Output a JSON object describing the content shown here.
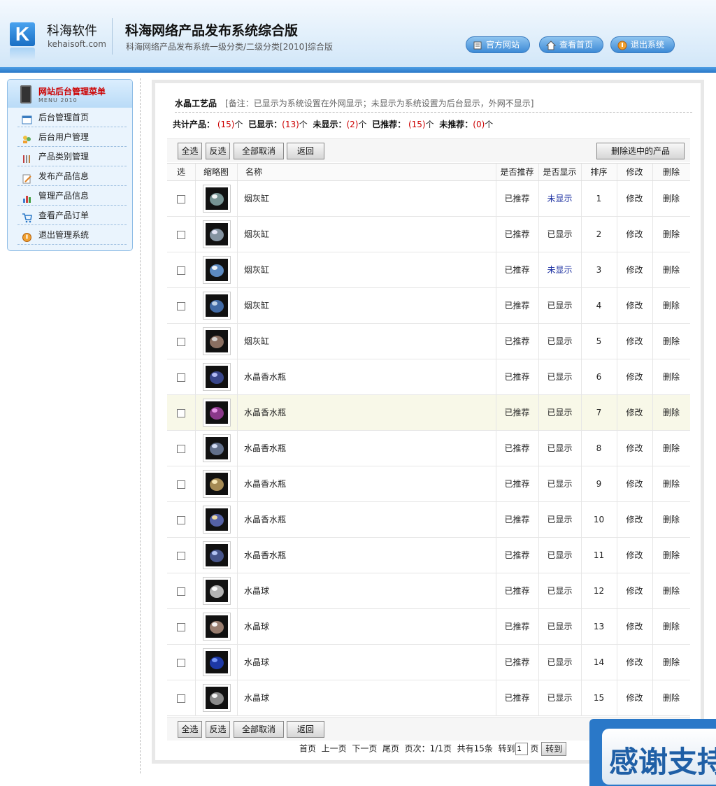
{
  "header": {
    "logo_letter": "K",
    "brand_name": "科海软件",
    "brand_url": "kehaisoft.com",
    "system_title": "科海网络产品发布系统综合版",
    "system_subtitle": "科海网络产品发布系统一级分类/二级分类[2010]综合版",
    "buttons": [
      {
        "label": "官方网站",
        "icon": "document-icon"
      },
      {
        "label": "查看首页",
        "icon": "home-icon"
      },
      {
        "label": "退出系统",
        "icon": "exit-icon"
      }
    ]
  },
  "sidebar": {
    "title": "网站后台管理菜单",
    "subtitle": "MENU 2010",
    "items": [
      {
        "label": "后台管理首页",
        "icon": "window-icon"
      },
      {
        "label": "后台用户管理",
        "icon": "users-icon"
      },
      {
        "label": "产品类别管理",
        "icon": "tools-icon"
      },
      {
        "label": "发布产品信息",
        "icon": "edit-icon"
      },
      {
        "label": "管理产品信息",
        "icon": "chart-icon"
      },
      {
        "label": "查看产品订单",
        "icon": "cart-icon"
      },
      {
        "label": "退出管理系统",
        "icon": "exit-icon"
      }
    ]
  },
  "main": {
    "category": "水晶工艺品",
    "note": "[备注：已显示为系统设置在外网显示；未显示为系统设置为后台显示，外网不显示]",
    "stats": {
      "total_label": "共计产品：",
      "total": "(15)",
      "shown_label": "已显示：",
      "shown": "(13)",
      "hidden_label": "未显示：",
      "hidden": "(2)",
      "recommended_label": "已推荐：",
      "recommended": "(15)",
      "not_recommended_label": "未推荐：",
      "not_recommended": "(0)",
      "unit": "个"
    },
    "buttons": {
      "select_all": "全选",
      "invert": "反选",
      "cancel_all": "全部取消",
      "back": "返回",
      "delete_selected": "删除选中的产品"
    },
    "columns": {
      "select": "选",
      "thumb": "缩略图",
      "name": "名称",
      "recommended": "是否推荐",
      "shown": "是否显示",
      "order": "排序",
      "edit": "修改",
      "delete": "删除"
    },
    "rows": [
      {
        "name": "烟灰缸",
        "recommended": "已推荐",
        "shown": "未显示",
        "order": "1",
        "edit": "修改",
        "delete": "删除"
      },
      {
        "name": "烟灰缸",
        "recommended": "已推荐",
        "shown": "已显示",
        "order": "2",
        "edit": "修改",
        "delete": "删除"
      },
      {
        "name": "烟灰缸",
        "recommended": "已推荐",
        "shown": "未显示",
        "order": "3",
        "edit": "修改",
        "delete": "删除"
      },
      {
        "name": "烟灰缸",
        "recommended": "已推荐",
        "shown": "已显示",
        "order": "4",
        "edit": "修改",
        "delete": "删除"
      },
      {
        "name": "烟灰缸",
        "recommended": "已推荐",
        "shown": "已显示",
        "order": "5",
        "edit": "修改",
        "delete": "删除"
      },
      {
        "name": "水晶香水瓶",
        "recommended": "已推荐",
        "shown": "已显示",
        "order": "6",
        "edit": "修改",
        "delete": "删除"
      },
      {
        "name": "水晶香水瓶",
        "recommended": "已推荐",
        "shown": "已显示",
        "order": "7",
        "edit": "修改",
        "delete": "删除"
      },
      {
        "name": "水晶香水瓶",
        "recommended": "已推荐",
        "shown": "已显示",
        "order": "8",
        "edit": "修改",
        "delete": "删除"
      },
      {
        "name": "水晶香水瓶",
        "recommended": "已推荐",
        "shown": "已显示",
        "order": "9",
        "edit": "修改",
        "delete": "删除"
      },
      {
        "name": "水晶香水瓶",
        "recommended": "已推荐",
        "shown": "已显示",
        "order": "10",
        "edit": "修改",
        "delete": "删除"
      },
      {
        "name": "水晶香水瓶",
        "recommended": "已推荐",
        "shown": "已显示",
        "order": "11",
        "edit": "修改",
        "delete": "删除"
      },
      {
        "name": "水晶球",
        "recommended": "已推荐",
        "shown": "已显示",
        "order": "12",
        "edit": "修改",
        "delete": "删除"
      },
      {
        "name": "水晶球",
        "recommended": "已推荐",
        "shown": "已显示",
        "order": "13",
        "edit": "修改",
        "delete": "删除"
      },
      {
        "name": "水晶球",
        "recommended": "已推荐",
        "shown": "已显示",
        "order": "14",
        "edit": "修改",
        "delete": "删除"
      },
      {
        "name": "水晶球",
        "recommended": "已推荐",
        "shown": "已显示",
        "order": "15",
        "edit": "修改",
        "delete": "删除"
      }
    ],
    "pager": {
      "first": "首页",
      "prev": "上一页",
      "next": "下一页",
      "last": "尾页",
      "page_info": "页次：1/1页",
      "total_info": "共有15条",
      "goto_label": "转到",
      "page_input_value": "1",
      "page_unit": "页",
      "goto_button": "转到"
    }
  },
  "overlay": {
    "text": "感谢支持"
  },
  "colors": {
    "accent": "#2a78c8",
    "red": "#cc0000",
    "hidden_blue": "#1a2ea0"
  }
}
